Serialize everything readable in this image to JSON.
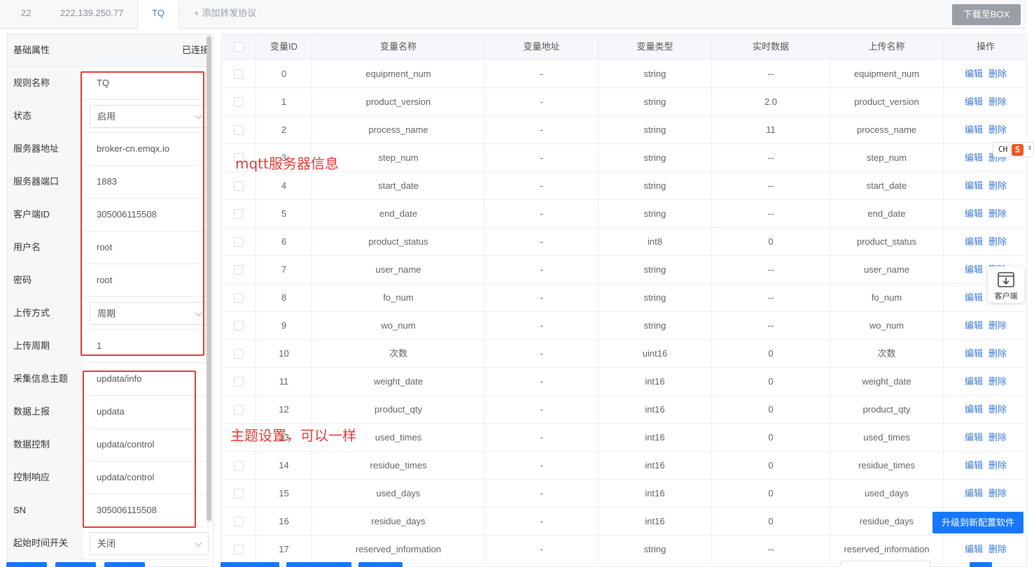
{
  "tabs": [
    {
      "label": "22"
    },
    {
      "label": "222.139.250.77"
    },
    {
      "label": "TQ",
      "active": true
    },
    {
      "label": "+ 添加转发协议"
    }
  ],
  "toolbar": {
    "download_label": "下载至BOX"
  },
  "props": {
    "header_title": "基础属性",
    "header_status": "已连接",
    "rows": [
      {
        "label": "规则名称",
        "value": "TQ"
      },
      {
        "label": "状态",
        "value": "启用",
        "type": "select"
      },
      {
        "label": "服务器地址",
        "value": "broker-cn.emqx.io"
      },
      {
        "label": "服务器端口",
        "value": "1883"
      },
      {
        "label": "客户端ID",
        "value": "305006115508"
      },
      {
        "label": "用户名",
        "value": "root"
      },
      {
        "label": "密码",
        "value": "root"
      },
      {
        "label": "上传方式",
        "value": "周期",
        "type": "select"
      },
      {
        "label": "上传周期",
        "value": "1"
      },
      {
        "label": "采集信息主题",
        "value": "updata/info"
      },
      {
        "label": "数据上报",
        "value": "updata"
      },
      {
        "label": "数据控制",
        "value": "updata/control"
      },
      {
        "label": "控制响应",
        "value": "updata/control"
      },
      {
        "label": "SN",
        "value": "305006115508"
      },
      {
        "label": "起始时间开关",
        "value": "关闭",
        "type": "select"
      }
    ]
  },
  "table": {
    "columns": [
      "变量ID",
      "变量名称",
      "变量地址",
      "变量类型",
      "实时数据",
      "上传名称",
      "操作"
    ],
    "edit_label": "编辑",
    "delete_label": "删除",
    "rows": [
      {
        "id": "0",
        "name": "equipment_num",
        "addr": "-",
        "type": "string",
        "data": "--",
        "upload": "equipment_num"
      },
      {
        "id": "1",
        "name": "product_version",
        "addr": "-",
        "type": "string",
        "data": "2.0",
        "upload": "product_version"
      },
      {
        "id": "2",
        "name": "process_name",
        "addr": "-",
        "type": "string",
        "data": "11",
        "upload": "process_name"
      },
      {
        "id": "3",
        "name": "step_num",
        "addr": "-",
        "type": "string",
        "data": "--",
        "upload": "step_num"
      },
      {
        "id": "4",
        "name": "start_date",
        "addr": "-",
        "type": "string",
        "data": "--",
        "upload": "start_date"
      },
      {
        "id": "5",
        "name": "end_date",
        "addr": "-",
        "type": "string",
        "data": "--",
        "upload": "end_date"
      },
      {
        "id": "6",
        "name": "product_status",
        "addr": "-",
        "type": "int8",
        "data": "0",
        "upload": "product_status"
      },
      {
        "id": "7",
        "name": "user_name",
        "addr": "-",
        "type": "string",
        "data": "--",
        "upload": "user_name"
      },
      {
        "id": "8",
        "name": "fo_num",
        "addr": "-",
        "type": "string",
        "data": "--",
        "upload": "fo_num"
      },
      {
        "id": "9",
        "name": "wo_num",
        "addr": "-",
        "type": "string",
        "data": "--",
        "upload": "wo_num"
      },
      {
        "id": "10",
        "name": "次数",
        "addr": "-",
        "type": "uint16",
        "data": "0",
        "upload": "次数"
      },
      {
        "id": "11",
        "name": "weight_date",
        "addr": "-",
        "type": "int16",
        "data": "0",
        "upload": "weight_date"
      },
      {
        "id": "12",
        "name": "product_qty",
        "addr": "-",
        "type": "int16",
        "data": "0",
        "upload": "product_qty"
      },
      {
        "id": "13",
        "name": "used_times",
        "addr": "-",
        "type": "int16",
        "data": "0",
        "upload": "used_times"
      },
      {
        "id": "14",
        "name": "residue_times",
        "addr": "-",
        "type": "int16",
        "data": "0",
        "upload": "residue_times"
      },
      {
        "id": "15",
        "name": "used_days",
        "addr": "-",
        "type": "int16",
        "data": "0",
        "upload": "used_days"
      },
      {
        "id": "16",
        "name": "residue_days",
        "addr": "-",
        "type": "int16",
        "data": "0",
        "upload": "residue_days"
      },
      {
        "id": "17",
        "name": "reserved_information",
        "addr": "-",
        "type": "string",
        "data": "--",
        "upload": "reserved_information"
      }
    ]
  },
  "annotations": {
    "server_info": "mqtt服务器信息",
    "topic_info": "主题设置，可以一样"
  },
  "ime": {
    "text": "CH",
    "badge": "S",
    "arrow": "⇕"
  },
  "client_widget": {
    "label": "客户端",
    "icon": "download-box-icon"
  },
  "upgrade": {
    "label": "升级到新配置软件"
  },
  "colors": {
    "accent": "#1677ff",
    "link": "#3a7bd5",
    "annotation": "#e53935",
    "download_btn": "#9a9fa6"
  }
}
